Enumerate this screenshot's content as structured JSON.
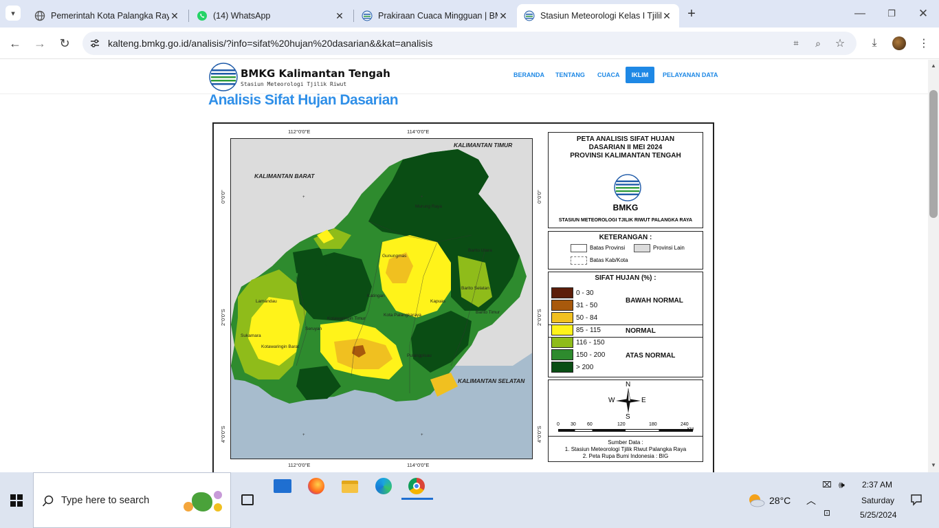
{
  "browser": {
    "tabs": [
      {
        "title": "Pemerintah Kota Palangka Raya",
        "icon": "globe-icon"
      },
      {
        "title": "(14) WhatsApp",
        "icon": "whatsapp-icon"
      },
      {
        "title": "Prakiraan Cuaca Mingguan | BMKG",
        "icon": "bmkg-icon"
      },
      {
        "title": "Stasiun Meteorologi Kelas I Tjilik Riwut",
        "icon": "bmkg-icon"
      }
    ],
    "url": "kalteng.bmkg.go.id/analisis/?info=sifat%20hujan%20dasarian&&kat=analisis"
  },
  "site": {
    "logo_name": "BMKG Kalimantan Tengah",
    "logo_sub": "Stasiun Meteorologi Tjilik Riwut",
    "nav": [
      "BERANDA",
      "TENTANG",
      "CUACA",
      "IKLIM",
      "PELAYANAN DATA"
    ],
    "active_nav": "IKLIM",
    "page_title": "Analisis Sifat Hujan Dasarian"
  },
  "map": {
    "coords_top": [
      "112°0'0\"E",
      "114°0'0\"E"
    ],
    "coords_bottom": [
      "112°0'0\"E",
      "114°0'0\"E"
    ],
    "coords_side": [
      "0°0'0\"",
      "2°0'0\"S",
      "4°0'0\"S"
    ],
    "region_labels": [
      "KALIMANTAN TIMUR",
      "KALIMANTAN BARAT",
      "KALIMANTAN SELATAN"
    ],
    "cities": [
      "Murung Raya",
      "Gunungmas",
      "Barito Utara",
      "Barito Selatan",
      "Katingan",
      "Kapuas",
      "Lamandau",
      "Kotawaringin Timur",
      "Kota Palangkaraya",
      "Barito Timur",
      "Seruyan",
      "Sukamara",
      "Kotawaringin Barat",
      "Pulangpisau"
    ],
    "title_lines": [
      "PETA ANALISIS SIFAT HUJAN",
      "DASARIAN II MEI 2024",
      "PROVINSI KALIMANTAN TENGAH"
    ],
    "bmkg_text": "BMKG",
    "station": "STASIUN METEOROLOGI TJILIK RIWUT PALANGKA RAYA",
    "keterangan_title": "KETERANGAN :",
    "keterangan": [
      "Batas Provinsi",
      "Provinsi Lain",
      "Batas Kab/Kota"
    ],
    "sifat_title": "SIFAT HUJAN (%) :",
    "legend": [
      {
        "range": "0 - 30",
        "color": "#5c1e0a"
      },
      {
        "range": "31 - 50",
        "color": "#a8590c"
      },
      {
        "range": "50 - 84",
        "color": "#f0c020"
      },
      {
        "range": "85 - 115",
        "color": "#fff31a"
      },
      {
        "range": "116 - 150",
        "color": "#8fbc1a"
      },
      {
        "range": "150 - 200",
        "color": "#2e8b2e"
      },
      {
        "range": "> 200",
        "color": "#0a4d14"
      }
    ],
    "categories": [
      "BAWAH NORMAL",
      "NORMAL",
      "ATAS NORMAL"
    ],
    "compass": {
      "n": "N",
      "s": "S",
      "e": "E",
      "w": "W"
    },
    "scale_labels": [
      "0",
      "30",
      "60",
      "120",
      "180",
      "240"
    ],
    "scale_unit": "KM",
    "sumber_title": "Sumber Data :",
    "sumber": [
      "1. Stasiun Meteorologi Tjilik Riwut Palangka Raya",
      "2. Peta Rupa Bumi Indonesia : BIG"
    ]
  },
  "taskbar": {
    "search_placeholder": "Type here to search",
    "weather": "28°C",
    "time": "2:37 AM",
    "day": "Saturday",
    "date": "5/25/2024"
  }
}
